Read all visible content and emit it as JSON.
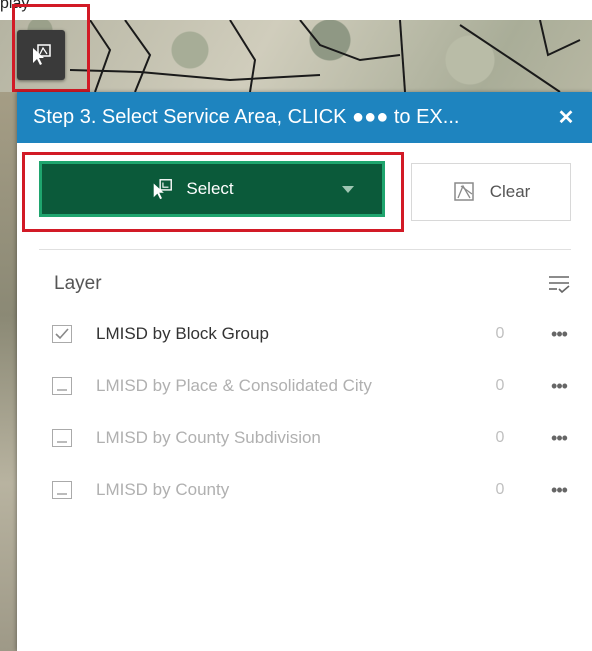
{
  "top_label": "play",
  "panel": {
    "title": "Step 3. Select Service Area, CLICK ●●● to EX..."
  },
  "toolbar": {
    "select_label": "Select",
    "clear_label": "Clear"
  },
  "layers": {
    "heading": "Layer",
    "items": [
      {
        "label": "LMISD by Block Group",
        "count": "0",
        "checked": true,
        "enabled": true
      },
      {
        "label": "LMISD by Place & Consolidated City",
        "count": "0",
        "checked": false,
        "enabled": false
      },
      {
        "label": "LMISD by County Subdivision",
        "count": "0",
        "checked": false,
        "enabled": false
      },
      {
        "label": "LMISD by County",
        "count": "0",
        "checked": false,
        "enabled": false
      }
    ],
    "more_glyph": "•••"
  },
  "colors": {
    "header_blue": "#1e84bf",
    "select_green": "#0b5a3a",
    "highlight_red": "#d21a26"
  }
}
